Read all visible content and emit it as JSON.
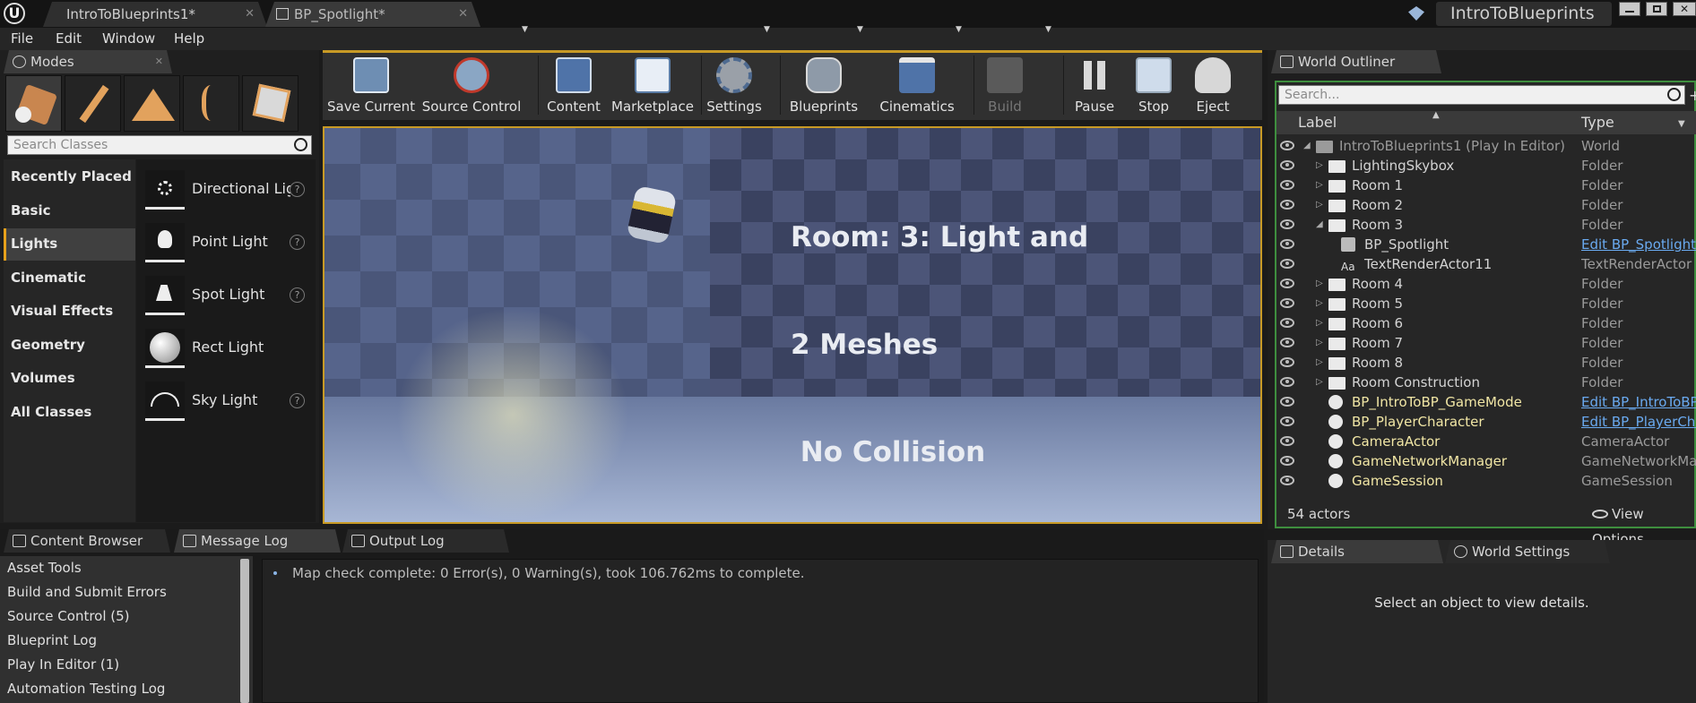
{
  "titlebar": {
    "tabs": [
      {
        "label": "IntroToBlueprints1*"
      },
      {
        "label": "BP_Spotlight*"
      }
    ],
    "project_name": "IntroToBlueprints"
  },
  "menu": [
    "File",
    "Edit",
    "Window",
    "Help"
  ],
  "modes": {
    "tab_label": "Modes",
    "search_placeholder": "Search Classes",
    "categories": [
      "Recently Placed",
      "Basic",
      "Lights",
      "Cinematic",
      "Visual Effects",
      "Geometry",
      "Volumes",
      "All Classes"
    ],
    "active_category": "Lights",
    "items": [
      {
        "label": "Directional Light",
        "icon": "directional-light-icon"
      },
      {
        "label": "Point Light",
        "icon": "point-light-icon"
      },
      {
        "label": "Spot Light",
        "icon": "spot-light-icon"
      },
      {
        "label": "Rect Light",
        "icon": "rect-light-icon"
      },
      {
        "label": "Sky Light",
        "icon": "sky-light-icon"
      }
    ],
    "help_glyph": "?"
  },
  "toolbar": {
    "buttons": [
      {
        "label": "Save Current",
        "icon": "save-icon"
      },
      {
        "label": "Source Control",
        "icon": "source-control-icon"
      },
      {
        "label": "Content",
        "icon": "content-icon"
      },
      {
        "label": "Marketplace",
        "icon": "marketplace-icon"
      },
      {
        "label": "Settings",
        "icon": "settings-icon"
      },
      {
        "label": "Blueprints",
        "icon": "blueprints-icon"
      },
      {
        "label": "Cinematics",
        "icon": "cinematics-icon"
      },
      {
        "label": "Build",
        "icon": "build-icon"
      },
      {
        "label": "Pause",
        "icon": "pause-icon"
      },
      {
        "label": "Stop",
        "icon": "stop-icon"
      },
      {
        "label": "Eject",
        "icon": "eject-icon"
      }
    ]
  },
  "viewport": {
    "text_lines": [
      "Room: 3: Light and",
      "2 Meshes",
      " No Collision"
    ]
  },
  "outliner": {
    "tab_label": "World Outliner",
    "search_placeholder": "Search...",
    "col_label": "Label",
    "col_type": "Type",
    "rows": [
      {
        "label": "IntroToBlueprints1 (Play In Editor)",
        "type": "World"
      },
      {
        "label": "LightingSkybox",
        "type": "Folder"
      },
      {
        "label": "Room 1",
        "type": "Folder"
      },
      {
        "label": "Room 2",
        "type": "Folder"
      },
      {
        "label": "Room 3",
        "type": "Folder"
      },
      {
        "label": "BP_Spotlight",
        "type": "Edit BP_Spotlight"
      },
      {
        "label": "TextRenderActor11",
        "type": "TextRenderActor"
      },
      {
        "label": "Room 4",
        "type": "Folder"
      },
      {
        "label": "Room 5",
        "type": "Folder"
      },
      {
        "label": "Room 6",
        "type": "Folder"
      },
      {
        "label": "Room 7",
        "type": "Folder"
      },
      {
        "label": "Room 8",
        "type": "Folder"
      },
      {
        "label": "Room Construction",
        "type": "Folder"
      },
      {
        "label": "BP_IntroToBP_GameMode",
        "type": "Edit BP_IntroToBP_GameMode"
      },
      {
        "label": "BP_PlayerCharacter",
        "type": "Edit BP_PlayerCharacter"
      },
      {
        "label": "CameraActor",
        "type": "CameraActor"
      },
      {
        "label": "GameNetworkManager",
        "type": "GameNetworkManager"
      },
      {
        "label": "GameSession",
        "type": "GameSession"
      }
    ],
    "actor_count": "54 actors",
    "view_options": "View Options"
  },
  "bottom": {
    "tabs": [
      "Content Browser",
      "Message Log",
      "Output Log"
    ],
    "log_categories": [
      "Asset Tools",
      "Build and Submit Errors",
      "Source Control (5)",
      "Blueprint Log",
      "Play In Editor (1)",
      "Automation Testing Log"
    ],
    "message": "Map check complete: 0 Error(s), 0 Warning(s), took 106.762ms to complete."
  },
  "details": {
    "tabs": [
      "Details",
      "World Settings"
    ],
    "empty_text": "Select an object to view details."
  }
}
